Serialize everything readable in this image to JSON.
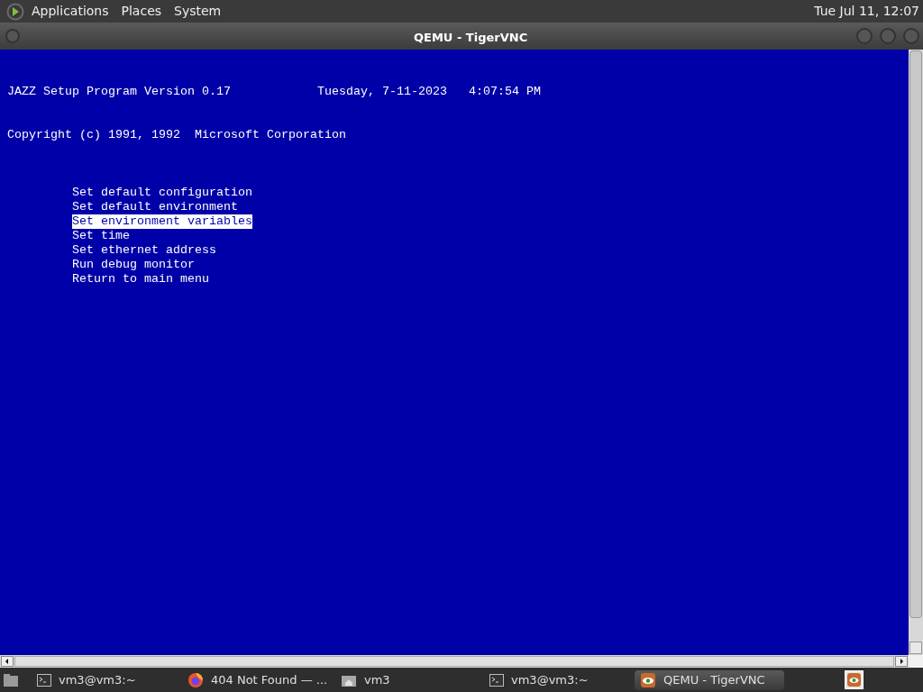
{
  "top_panel": {
    "menus": [
      "Applications",
      "Places",
      "System"
    ],
    "clock": "Tue Jul 11, 12:07"
  },
  "window": {
    "title": "QEMU - TigerVNC"
  },
  "console": {
    "header": {
      "program": "JAZZ Setup Program Version 0.17",
      "date": "Tuesday, 7-11-2023",
      "time": "4:07:54 PM"
    },
    "copyright": "Copyright (c) 1991, 1992  Microsoft Corporation",
    "menu": [
      {
        "label": "Set default configuration",
        "selected": false
      },
      {
        "label": "Set default environment",
        "selected": false
      },
      {
        "label": "Set environment variables",
        "selected": true
      },
      {
        "label": "Set time",
        "selected": false
      },
      {
        "label": "Set ethernet address",
        "selected": false
      },
      {
        "label": "Run debug monitor",
        "selected": false
      },
      {
        "label": "Return to main menu",
        "selected": false
      }
    ]
  },
  "taskbar": {
    "tasks": [
      {
        "kind": "terminal",
        "label": "vm3@vm3:~",
        "selected": false
      },
      {
        "kind": "browser",
        "label": "404 Not Found — ...",
        "selected": false
      },
      {
        "kind": "folder",
        "label": "vm3",
        "selected": false
      },
      {
        "kind": "terminal",
        "label": "vm3@vm3:~",
        "selected": false
      },
      {
        "kind": "vnc",
        "label": "QEMU - TigerVNC",
        "selected": true
      }
    ]
  }
}
